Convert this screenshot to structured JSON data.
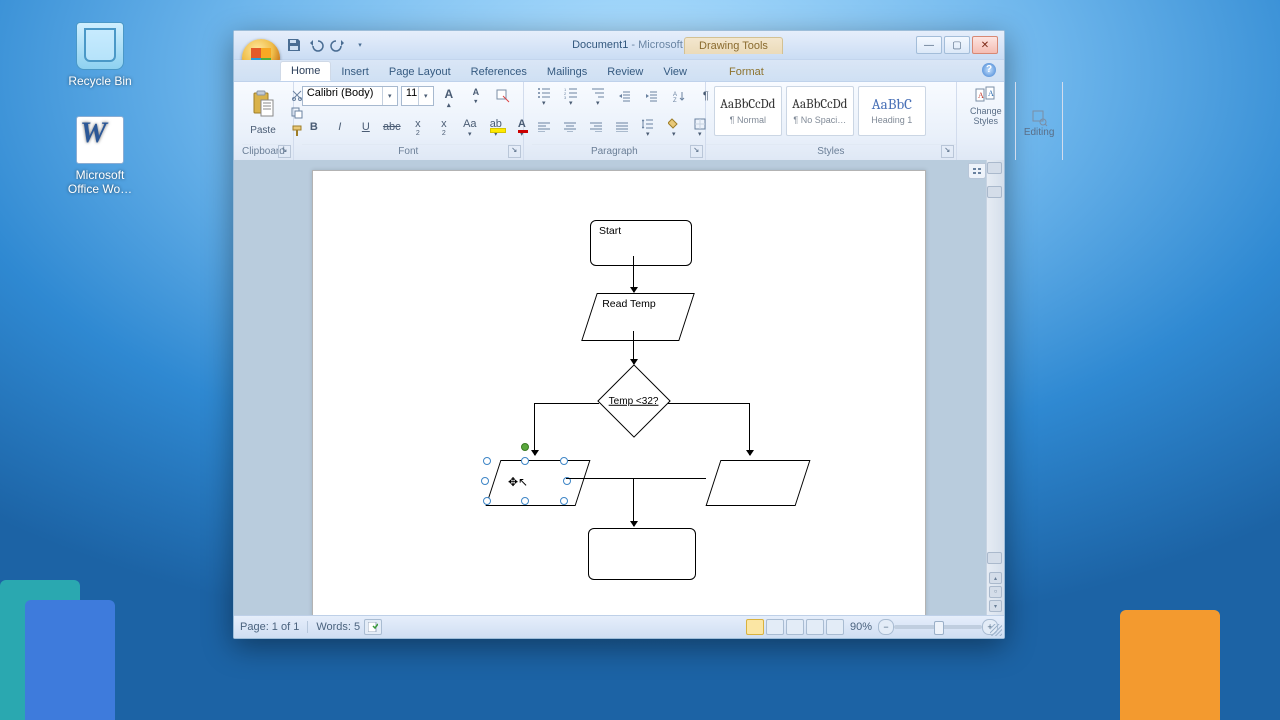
{
  "desktop": {
    "recycle_bin": "Recycle Bin",
    "word_shortcut": "Microsoft Office Wo…"
  },
  "window": {
    "title_doc": "Document1",
    "title_app": " - Microsoft Word",
    "context_tab_group": "Drawing Tools"
  },
  "tabs": {
    "home": "Home",
    "insert": "Insert",
    "page_layout": "Page Layout",
    "references": "References",
    "mailings": "Mailings",
    "review": "Review",
    "view": "View",
    "format": "Format"
  },
  "ribbon": {
    "clipboard": {
      "paste": "Paste",
      "label": "Clipboard"
    },
    "font": {
      "name": "Calibri (Body)",
      "size": "11",
      "label": "Font"
    },
    "paragraph": {
      "label": "Paragraph"
    },
    "styles": {
      "label": "Styles",
      "preview_text": "AaBbCcDd",
      "preview_text_alt": "AaBbC",
      "item1": "¶ Normal",
      "item2": "¶ No Spaci…",
      "item3": "Heading 1",
      "change": "Change Styles"
    },
    "editing": {
      "label": "Editing"
    }
  },
  "flowchart": {
    "start": "Start",
    "read_temp": "Read Temp",
    "decision": "Temp <32?"
  },
  "statusbar": {
    "page": "Page: 1 of 1",
    "words": "Words: 5",
    "zoom": "90%"
  }
}
